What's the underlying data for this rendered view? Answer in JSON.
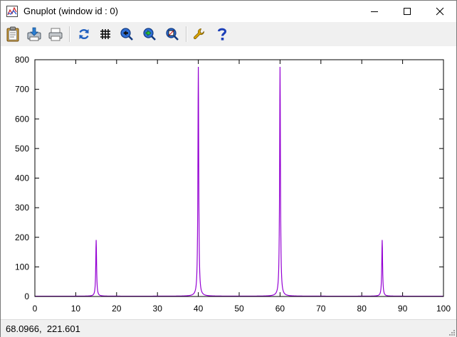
{
  "window": {
    "title": "Gnuplot (window id : 0)"
  },
  "toolbar": {
    "buttons": [
      {
        "name": "copy-clipboard-icon"
      },
      {
        "name": "print-save-icon"
      },
      {
        "name": "print-icon"
      },
      {
        "name": "replot-icon"
      },
      {
        "name": "grid-toggle-icon"
      },
      {
        "name": "zoom-previous-icon"
      },
      {
        "name": "zoom-next-icon"
      },
      {
        "name": "unzoom-icon"
      },
      {
        "name": "options-wrench-icon"
      },
      {
        "name": "help-icon"
      }
    ]
  },
  "chart_data": {
    "type": "line",
    "title": "",
    "xlabel": "",
    "ylabel": "",
    "xlim": [
      0,
      100
    ],
    "ylim": [
      0,
      800
    ],
    "xticks": [
      0,
      10,
      20,
      30,
      40,
      50,
      60,
      70,
      80,
      90,
      100
    ],
    "yticks": [
      0,
      100,
      200,
      300,
      400,
      500,
      600,
      700,
      800
    ],
    "line_color": "#9400d3",
    "grid": false,
    "series": [
      {
        "peaks": [
          {
            "x": 15,
            "y": 190
          },
          {
            "x": 40,
            "y": 775
          },
          {
            "x": 60,
            "y": 775
          },
          {
            "x": 85,
            "y": 190
          }
        ],
        "baseline": 1
      }
    ]
  },
  "status": {
    "coords": "68.0966,  221.601"
  }
}
